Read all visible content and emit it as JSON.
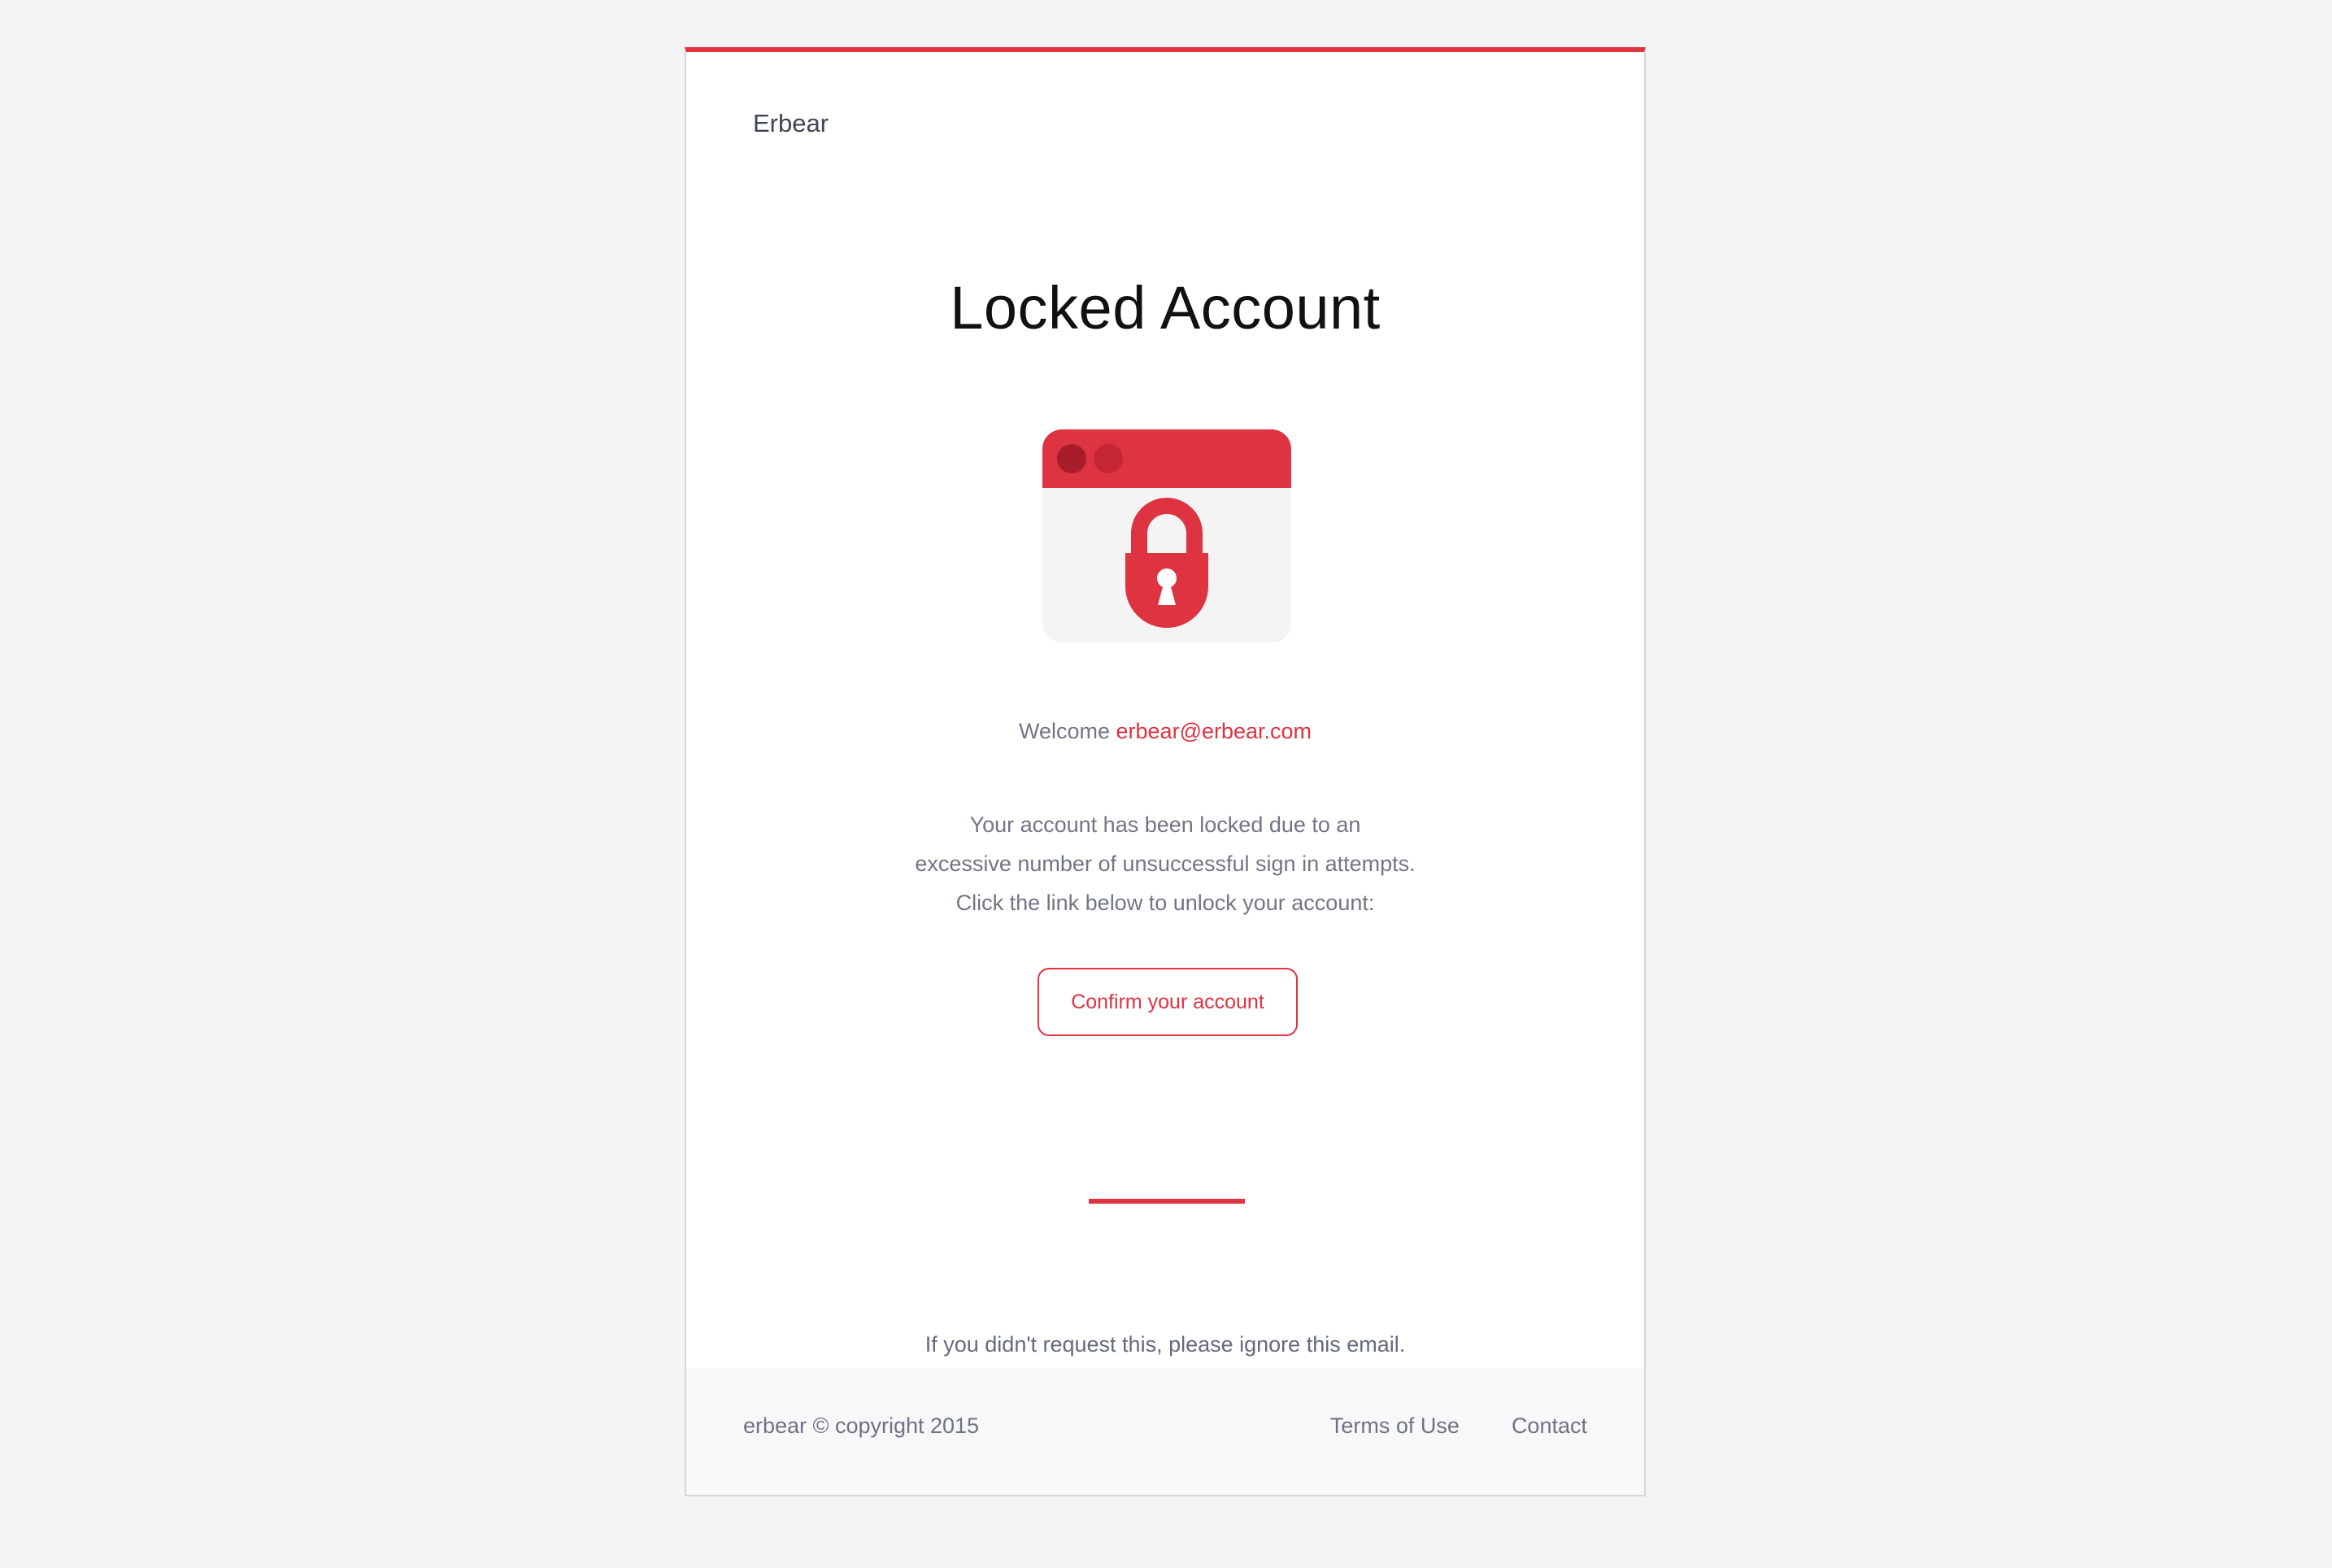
{
  "header": {
    "brand": "Erbear"
  },
  "main": {
    "title": "Locked Account",
    "illustration": {
      "icon": "lock-icon",
      "colors": {
        "accent": "#de3341",
        "dot_dark": "#a71d2a",
        "dot_mid": "#c42636",
        "window_body": "#f3f4f3"
      }
    },
    "welcome_prefix": "Welcome",
    "email": "erbear@erbear.com",
    "message_lines": [
      "Your account has been locked due to an",
      "excessive number of unsuccessful sign in attempts.",
      "Click the link below to unlock your account:"
    ],
    "confirm_label": "Confirm your account",
    "ignore_note": "If you didn't request this, please ignore this email."
  },
  "footer": {
    "copyright": "erbear © copyright 2015",
    "links": [
      {
        "label": "Terms of Use"
      },
      {
        "label": "Contact"
      }
    ]
  },
  "colors": {
    "accent": "#de3341",
    "background": "#f3f4f3",
    "text_muted": "#717684"
  }
}
